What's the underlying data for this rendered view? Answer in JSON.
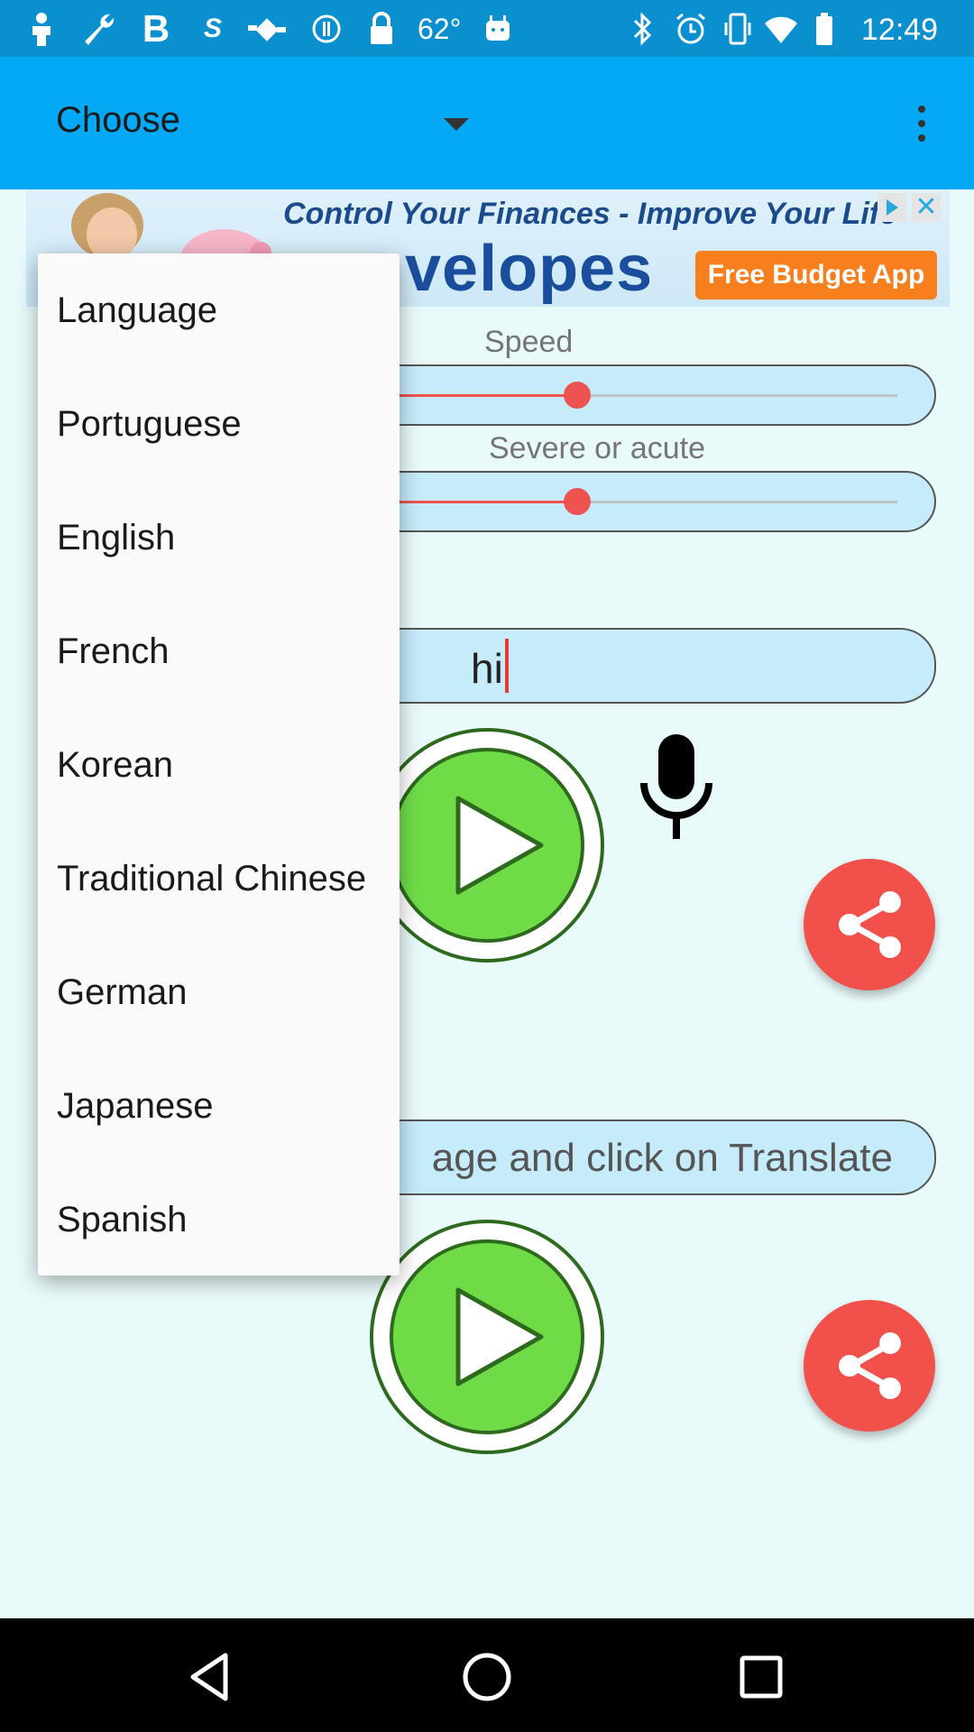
{
  "status_bar": {
    "temperature": "62°",
    "time": "12:49",
    "icons": [
      "person-icon",
      "wrench-icon",
      "bold-b-icon",
      "sync-icon",
      "fake-gps-icon",
      "info-circle-icon",
      "lock-icon",
      "android-icon",
      "bluetooth-icon",
      "alarm-icon",
      "vibrate-icon",
      "wifi-icon",
      "battery-icon"
    ]
  },
  "toolbar": {
    "spinner_label": "Choose",
    "menu_icon": "more-vertical-icon"
  },
  "ad": {
    "headline": "Control Your Finances - Improve Your Life",
    "brand": "velopes",
    "cta": "Free Budget App"
  },
  "main": {
    "speed_label": "Speed",
    "speed_value": 0.46,
    "pitch_label": "Severe or acute",
    "pitch_value": 0.46,
    "input_text": "hi",
    "output_text": "age and click on Translate"
  },
  "dropdown": {
    "items": [
      {
        "label": "Language"
      },
      {
        "label": "Portuguese"
      },
      {
        "label": "English"
      },
      {
        "label": "French"
      },
      {
        "label": "Korean"
      },
      {
        "label": "Traditional Chinese"
      },
      {
        "label": "German"
      },
      {
        "label": "Japanese"
      },
      {
        "label": "Spanish"
      }
    ]
  },
  "nav": {
    "back": "back-icon",
    "home": "home-icon",
    "recents": "recents-icon"
  },
  "colors": {
    "app_bar": "#03a9f4",
    "status_bar": "#0a8fcf",
    "accent": "#f1514a",
    "play_green": "#6fdc47",
    "background": "#e9fafa"
  }
}
